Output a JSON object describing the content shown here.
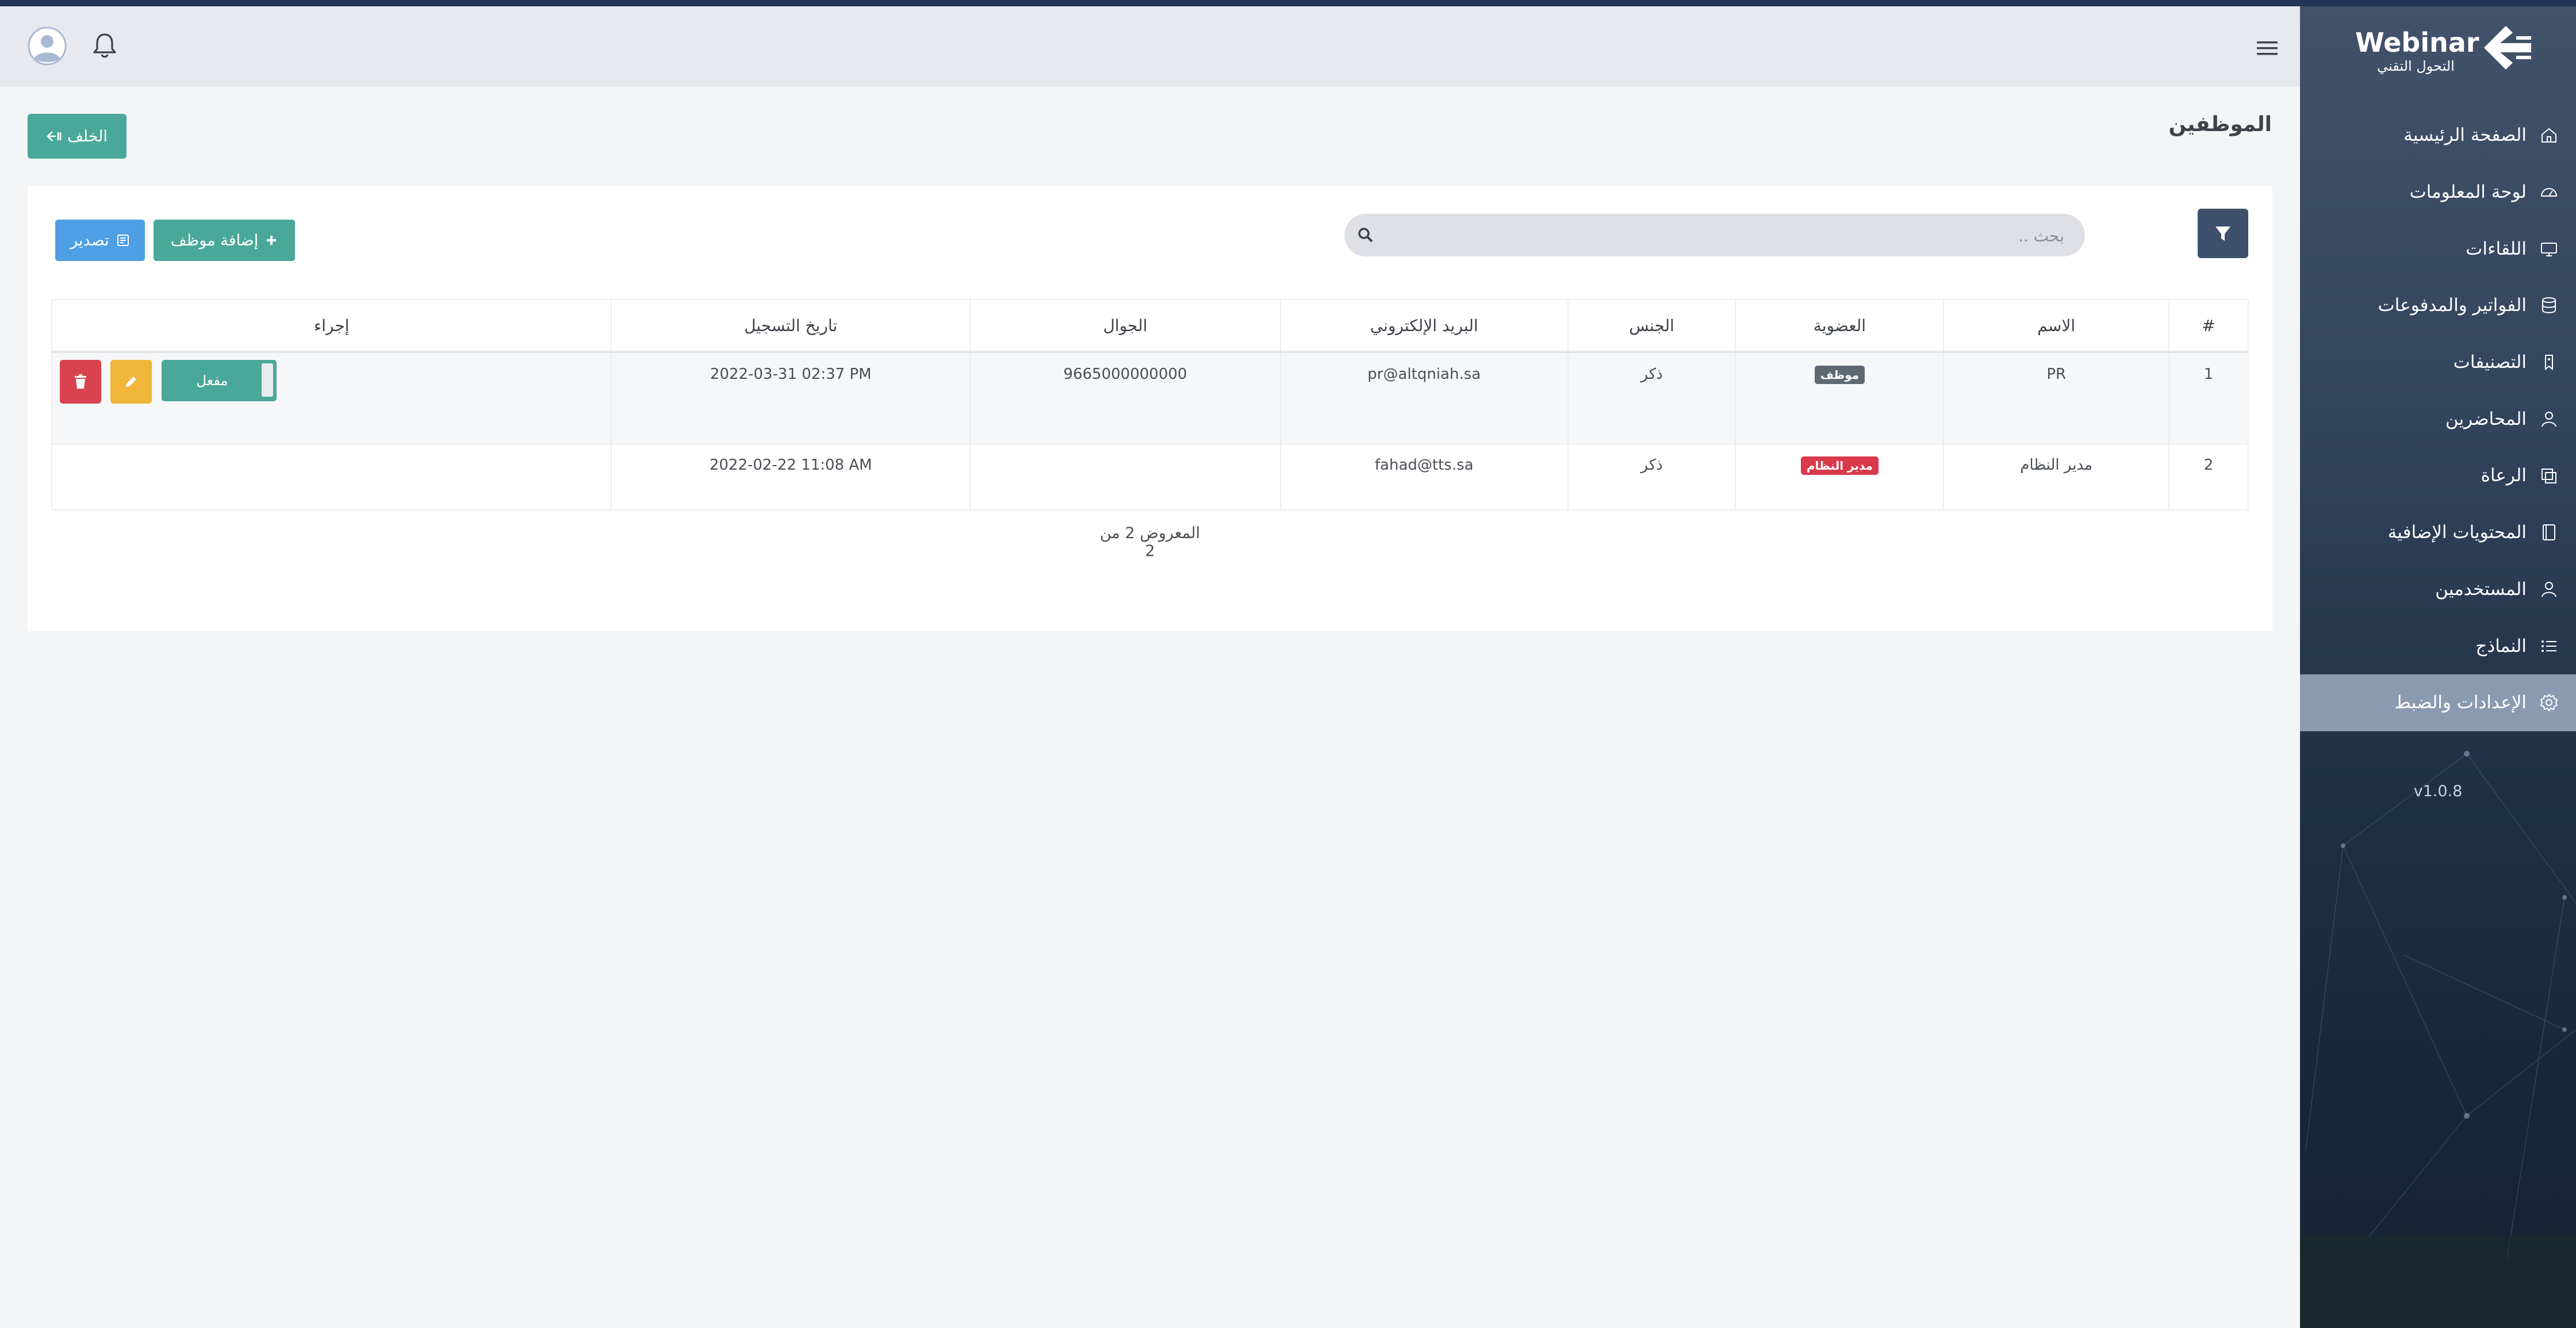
{
  "brand": {
    "name": "Webinar",
    "subtitle": "التحول التقني"
  },
  "sidebar": {
    "items": [
      {
        "label": "الصفحة الرئيسية",
        "icon": "home-icon"
      },
      {
        "label": "لوحة المعلومات",
        "icon": "dashboard-gauge-icon"
      },
      {
        "label": "اللقاءات",
        "icon": "monitor-icon"
      },
      {
        "label": "الفواتير والمدفوعات",
        "icon": "database-icon"
      },
      {
        "label": "التصنيفات",
        "icon": "tag-icon"
      },
      {
        "label": "المحاضرين",
        "icon": "user-icon"
      },
      {
        "label": "الرعاة",
        "icon": "sponsors-icon"
      },
      {
        "label": "المحتويات الإضافية",
        "icon": "book-icon"
      },
      {
        "label": "المستخدمين",
        "icon": "user-icon"
      },
      {
        "label": "النماذج",
        "icon": "list-icon"
      },
      {
        "label": "الإعدادات والضبط",
        "icon": "gear-icon",
        "active": true
      }
    ],
    "version": "v1.0.8"
  },
  "header": {
    "page_title": "الموظفين",
    "back_label": "الخلف"
  },
  "toolbar": {
    "search_placeholder": "بحث ..",
    "add_label": "إضافة موظف",
    "export_label": "تصدير"
  },
  "table": {
    "columns": [
      "#",
      "الاسم",
      "العضوية",
      "الجنس",
      "البريد الإلكتروني",
      "الجوال",
      "تاريخ التسجيل",
      "إجراء"
    ],
    "rows": [
      {
        "num": "1",
        "name": "PR",
        "membership": "موظف",
        "gender": "ذكر",
        "email": "pr@altqniah.sa",
        "phone": "9665000000000",
        "registered": "2022-03-31 02:37 PM",
        "status": "مفعل"
      },
      {
        "num": "2",
        "name": "مدير النظام",
        "membership": "مدير النظام",
        "gender": "ذكر",
        "email": "fahad@tts.sa",
        "phone": "",
        "registered": "2022-02-22 11:08 AM"
      }
    ]
  },
  "footer": {
    "count_text": "المعروض 2 من 2"
  },
  "colors": {
    "primary_teal": "#4aa89a",
    "export_blue": "#4e9fe3",
    "sidebar_dark": "#33445d",
    "warning": "#f1b53a",
    "danger": "#d9434f"
  }
}
